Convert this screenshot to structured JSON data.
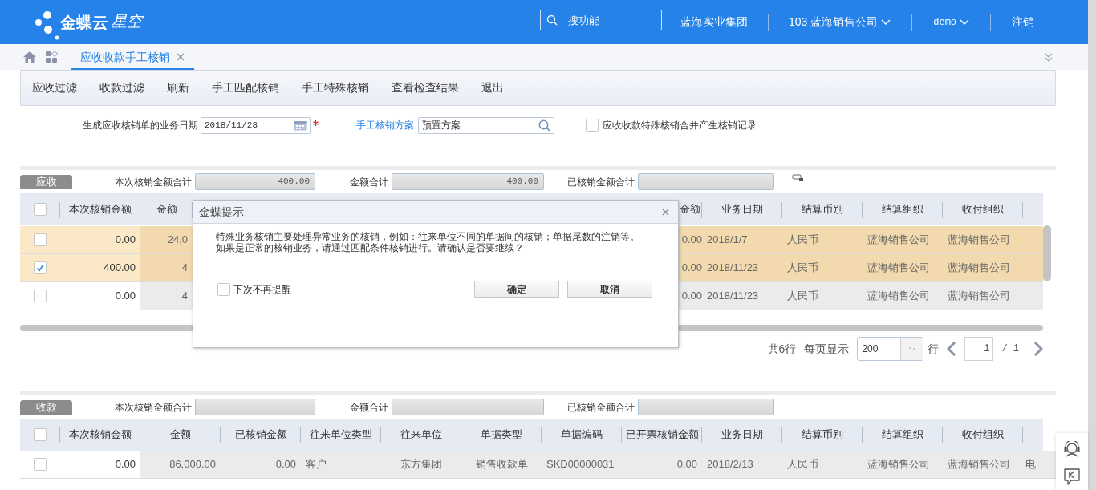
{
  "header": {
    "logo_text": "金蝶云",
    "logo_sub": "星空",
    "search_placeholder": "搜功能",
    "group": "蓝海实业集团",
    "company": "103 蓝海销售公司",
    "user": "demo",
    "logout": "注销"
  },
  "tabs": [
    {
      "label": "应收收款手工核销",
      "selected": true
    }
  ],
  "toolbar": [
    "应收过滤",
    "收款过滤",
    "刷新",
    "手工匹配核销",
    "手工特殊核销",
    "查看检查结果",
    "退出"
  ],
  "form": {
    "date_label": "生成应收核销单的业务日期",
    "date_value": "2018/11/28",
    "required": true,
    "scheme_label": "手工核销方案",
    "scheme_value": "预置方案",
    "merge_option": {
      "label": "应收收款特殊核销合并产生核销记录",
      "checked": false
    }
  },
  "receivable": {
    "tab": "应收",
    "all_checked": false,
    "summaries": [
      {
        "label": "本次核销金额合计",
        "value": "400.00"
      },
      {
        "label": "金额合计",
        "value": "400.00"
      },
      {
        "label": "已核销金额合计"
      }
    ],
    "columns": [
      "本次核销金额",
      "金额",
      "金额",
      "业务日期",
      "结算币别",
      "结算组织",
      "收付组织"
    ],
    "rows": [
      {
        "checked": false,
        "highlighted": true,
        "cells": [
          "0.00",
          "24,0",
          "0.00",
          "2018/1/7",
          "人民币",
          "蓝海销售公司",
          "蓝海销售公司"
        ]
      },
      {
        "checked": true,
        "highlighted": true,
        "cells": [
          "400.00",
          "4",
          "0.00",
          "2018/11/23",
          "人民币",
          "蓝海销售公司",
          "蓝海销售公司"
        ]
      },
      {
        "checked": false,
        "highlighted": false,
        "cells": [
          "0.00",
          "4",
          "0.00",
          "2018/11/23",
          "人民币",
          "蓝海销售公司",
          "蓝海销售公司"
        ]
      }
    ],
    "pager": {
      "total": "共6行",
      "per_page_label": "每页显示",
      "per_page": "200",
      "unit": "行",
      "page": "1",
      "pages": "/ 1"
    }
  },
  "payment": {
    "tab": "收款",
    "all_checked": false,
    "summaries": [
      {
        "label": "本次核销金额合计"
      },
      {
        "label": "金额合计"
      },
      {
        "label": "已核销金额合计"
      }
    ],
    "columns": [
      "本次核销金额",
      "金额",
      "已核销金额",
      "往来单位类型",
      "往来单位",
      "单据类型",
      "单据编码",
      "已开票核销金额",
      "业务日期",
      "结算币别",
      "结算组织",
      "收付组织"
    ],
    "rows": [
      {
        "checked": false,
        "highlighted": false,
        "cells": [
          "0.00",
          "86,000.00",
          "0.00",
          "客户",
          "东方集团",
          "销售收款单",
          "SKD00000031",
          "0.00",
          "2018/2/13",
          "人民币",
          "蓝海销售公司",
          "蓝海销售公司",
          "电"
        ]
      }
    ]
  },
  "dialog": {
    "title": "金蝶提示",
    "message": [
      "特殊业务核销主要处理异常业务的核销，例如：往来单位不同的单据间的核销；单据尾数的注销等。",
      "如果是正常的核销业务，请通过匹配条件核销进行。请确认是否要继续？"
    ],
    "dont_remind": {
      "label": "下次不再提醒",
      "checked": false
    },
    "buttons": [
      "确定",
      "取消"
    ]
  }
}
